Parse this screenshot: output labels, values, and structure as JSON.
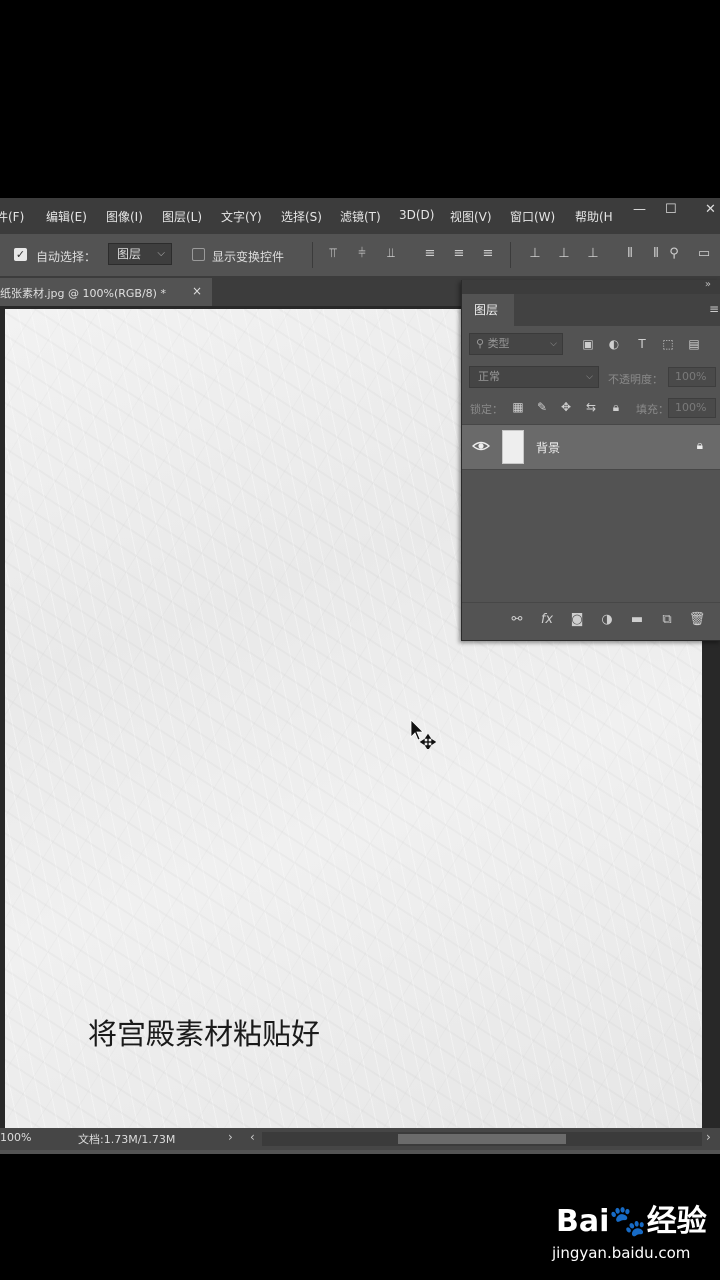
{
  "menubar": {
    "items": [
      "件(F)",
      "编辑(E)",
      "图像(I)",
      "图层(L)",
      "文字(Y)",
      "选择(S)",
      "滤镜(T)",
      "3D(D)",
      "视图(V)",
      "窗口(W)",
      "帮助(H"
    ],
    "min_glyph": "—",
    "max_glyph": "☐",
    "close_glyph": "✕"
  },
  "options": {
    "auto_select_label": "自动选择：",
    "auto_select_value": "图层",
    "show_transform_label": "显示变换控件"
  },
  "document": {
    "tab_title": "纸张素材.jpg @ 100%(RGB/8) *",
    "close_glyph": "×"
  },
  "canvas": {
    "caption": "将宫殿素材粘贴好"
  },
  "layers_panel": {
    "title": "图层",
    "filter_kind": "类型",
    "blend_mode": "正常",
    "opacity_label": "不透明度：",
    "opacity_value": "100%",
    "lock_label": "锁定：",
    "fill_label": "填充：",
    "fill_value": "100%",
    "layers": [
      {
        "name": "背景",
        "visible": true,
        "locked": true
      }
    ]
  },
  "statusbar": {
    "zoom": "100%",
    "doc_info": "文档:1.73M/1.73M"
  },
  "watermark": {
    "logo_text": "Bai🐾经验",
    "url": "jingyan.baidu.com"
  },
  "colors": {
    "app_bg": "#535353",
    "menubar_bg": "#3c3c3c",
    "panel_selected_row": "#6a6a6a",
    "paper": "#eeeeee"
  }
}
